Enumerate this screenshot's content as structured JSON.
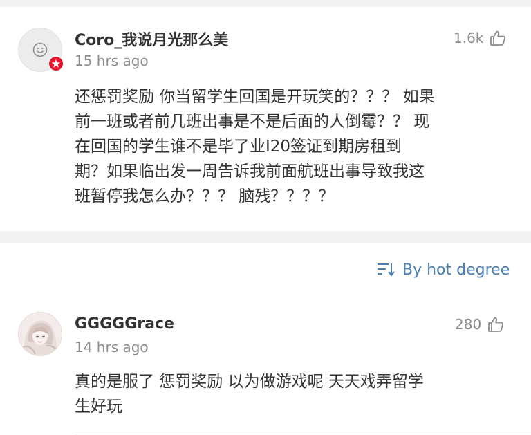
{
  "comments": [
    {
      "username": "Coro_我说月光那么美",
      "time": "15 hrs ago",
      "likes": "1.6k",
      "avatar_icon": "smiley-face-icon",
      "verified_badge_icon": "star-icon",
      "text": "还惩罚奖励 你当留学生回国是开玩笑的？？？ 如果\n前一班或者前几班出事是不是后面的人倒霉？？ 现\n在回国的学生谁不是毕了业I20签证到期房租到\n期？如果临出发一周告诉我前面航班出事导致我这\n班暂停我怎么办？？？ 脑残？？？？"
    },
    {
      "username": "GGGGGrace",
      "time": "14 hrs ago",
      "likes": "280",
      "avatar_icon": "anime-girl-avatar-icon",
      "text": "真的是服了 惩罚奖励 以为做游戏呢 天天戏弄留学\n生好玩"
    }
  ],
  "sort": {
    "label": "By hot degree",
    "icon": "sort-icon"
  },
  "colors": {
    "background": "#f2f2f2",
    "card": "#ffffff",
    "text": "#333333",
    "meta": "#8c8c8c",
    "link": "#4a7fb6",
    "badge": "#e6162d"
  }
}
